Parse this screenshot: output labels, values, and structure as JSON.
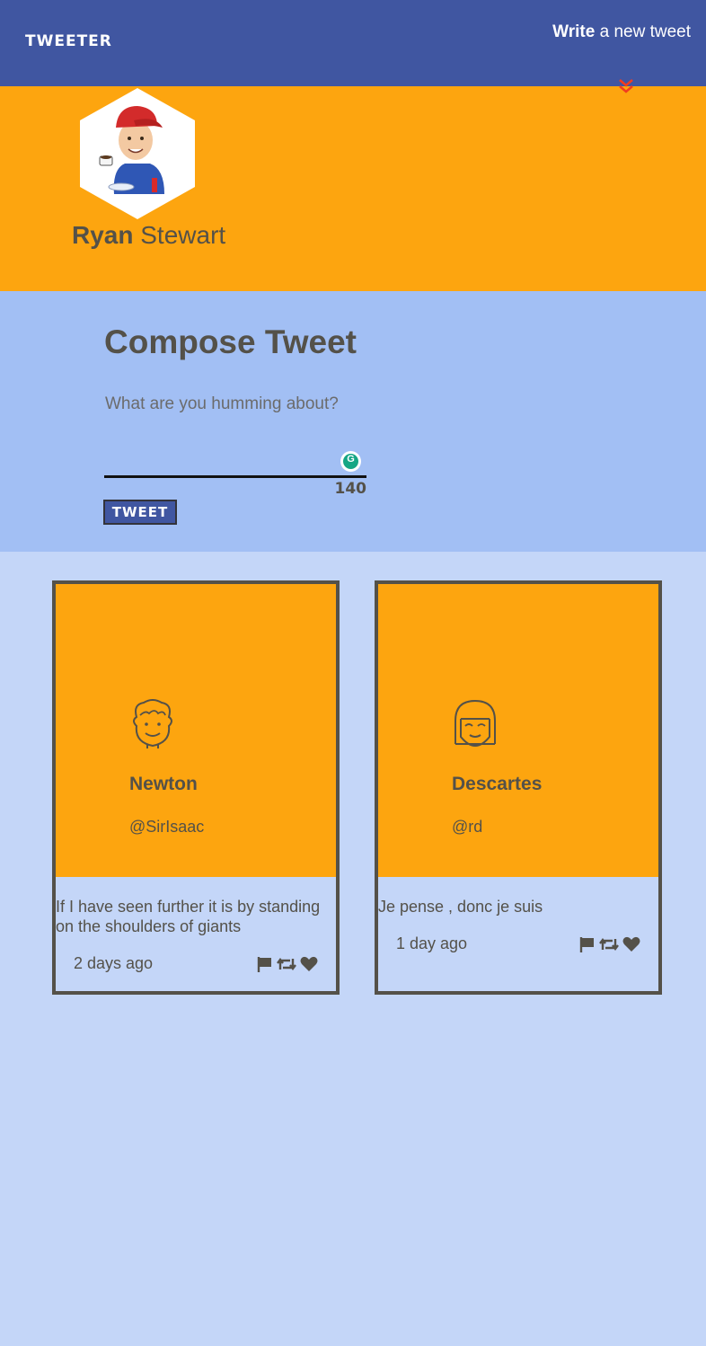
{
  "nav": {
    "brand": "TWEETER",
    "write_bold": "Write",
    "write_rest": " a new tweet"
  },
  "profile": {
    "first_name": "Ryan",
    "last_name": " Stewart"
  },
  "compose": {
    "title": "Compose Tweet",
    "prompt": "What are you humming about?",
    "counter": "140",
    "button_label": "TWEET"
  },
  "tweets": [
    {
      "name": "Newton",
      "handle": "@SirIsaac",
      "text": "If I have seen further it is by standing on the shoulders of giants",
      "time": "2 days ago"
    },
    {
      "name": "Descartes",
      "handle": "@rd",
      "text": "Je pense , donc je suis",
      "time": "1 day ago"
    }
  ],
  "colors": {
    "nav": "#4056a1",
    "header": "#fda50f",
    "compose": "#a2bff4",
    "page": "#c4d6f8",
    "text": "#545149",
    "accent": "#f13c20"
  },
  "icons": {
    "toggle": "chevron-double-down-icon",
    "flag": "flag-icon",
    "retweet": "retweet-icon",
    "like": "heart-icon"
  }
}
